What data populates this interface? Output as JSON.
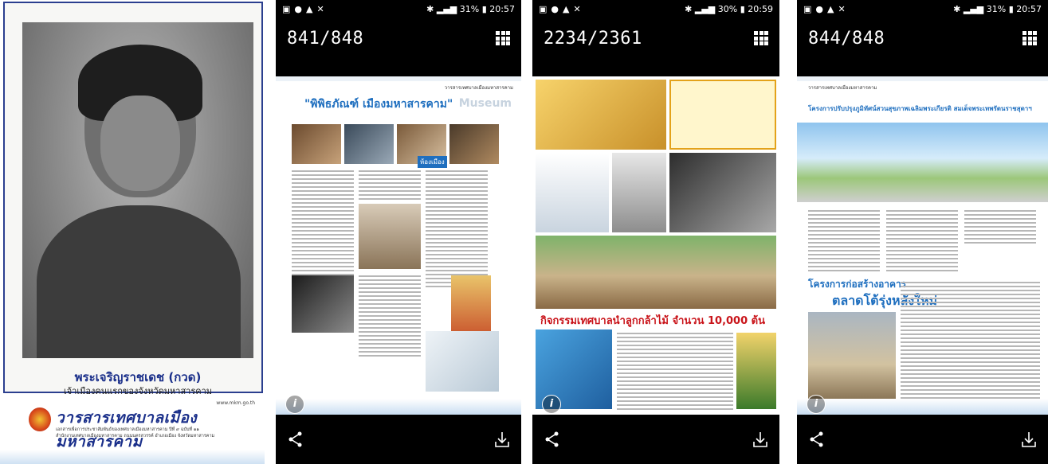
{
  "cover": {
    "caption_main": "พระเจริญราชเดช (กวด)",
    "caption_sub": "เจ้าเมืองคนแรกของจังหวัดมหาสารคาม",
    "url": "www.mkm.go.th",
    "masthead": "วารสารเทศบาลเมืองมหาสารคาม",
    "publisher_line1": "เอกสารเพื่อการประชาสัมพันธ์ของเทศบาลเมืองมหาสารคาม  ปีที่ ๙ ฉบับที่ ๑๑",
    "publisher_line2": "สำนักงานเทศบาลเมืองมหาสารคาม ถนนนครสวรรค์ อำเภอเมือง จังหวัดมหาสารคาม"
  },
  "phones": [
    {
      "status_time": "20:57",
      "status_battery": "31%",
      "counter": "841/848",
      "page_title": "\"พิพิธภัณฑ์ เมืองมหาสารคาม\"",
      "page_label": "วารสารเทศบาลเมืองมหาสารคาม",
      "badge": "ห้องเมือง"
    },
    {
      "status_time": "20:59",
      "status_battery": "30%",
      "counter": "2234/2361",
      "page_title": "กิจกรรมเทศบาลนำลูกกล้าไม้ จำนวน 10,000 ต้น"
    },
    {
      "status_time": "20:57",
      "status_battery": "31%",
      "counter": "844/848",
      "page_title": "โครงการปรับปรุงภูมิทัศน์สวนสุขภาพเฉลิมพระเกียรติ สมเด็จพระเทพรัตนราชสุดาฯ",
      "section_title_1": "โครงการก่อสร้างอาคาร",
      "section_title_2": "ตลาดโต้รุ่งหลังใหม่",
      "page_label": "วารสารเทศบาลเมืองมหาสารคาม"
    }
  ],
  "icons": {
    "info": "info-icon",
    "share": "share-icon",
    "download": "download-icon",
    "grid": "grid-icon"
  },
  "colors": {
    "accent_blue": "#1f6fbf",
    "masthead_blue": "#1a2f8a",
    "alert_red": "#c9141a"
  }
}
